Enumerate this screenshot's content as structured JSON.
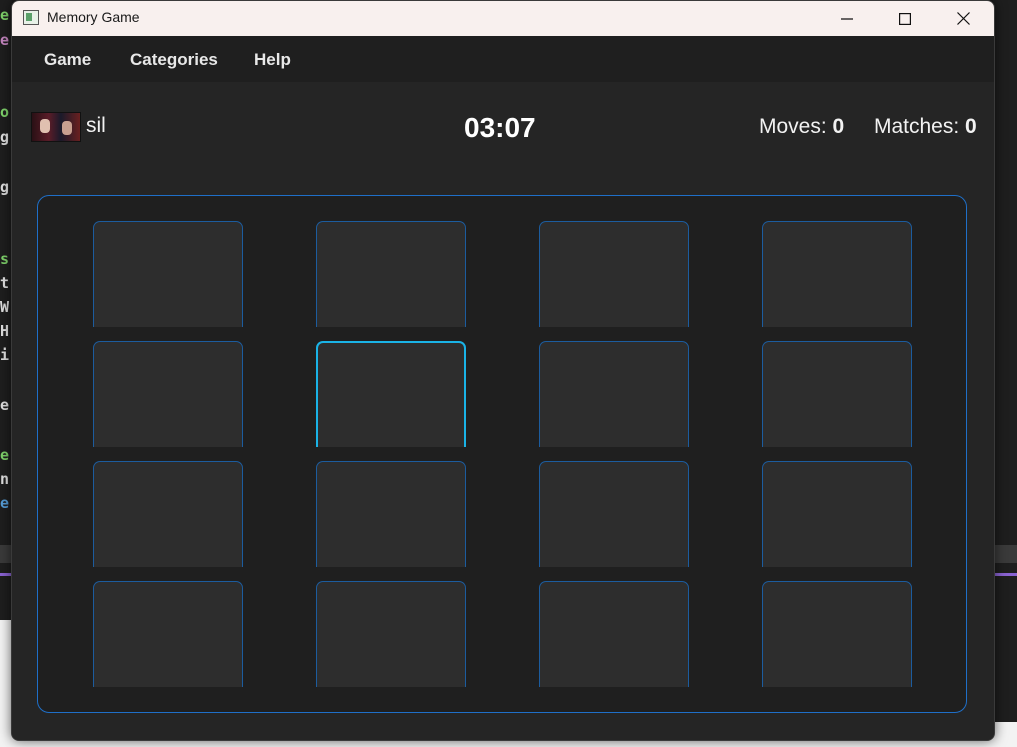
{
  "window": {
    "title": "Memory Game",
    "icon": "app-icon",
    "controls": [
      "minimize-icon",
      "maximize-icon",
      "close-icon"
    ]
  },
  "menu": {
    "items": [
      "Game",
      "Categories",
      "Help"
    ]
  },
  "status": {
    "player_name": "sil",
    "timer": "03:07",
    "moves_label": "Moves:",
    "moves_value": "0",
    "matches_label": "Matches:",
    "matches_value": "0"
  },
  "board": {
    "rows": 4,
    "cols": 4,
    "focused_card": {
      "row": 2,
      "col": 2
    }
  },
  "colors": {
    "accent": "#1f6fc8",
    "focus": "#1ab3e6",
    "card": "#2d2d2d",
    "background": "#252525"
  }
}
